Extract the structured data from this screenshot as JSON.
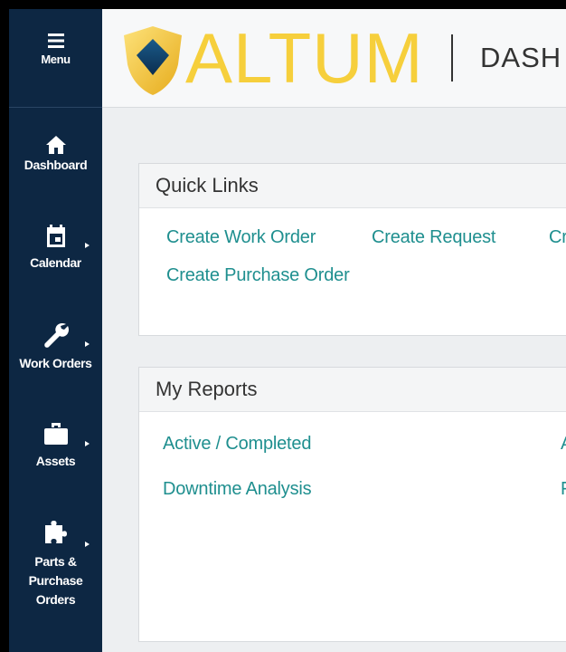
{
  "sidebar": {
    "menu_label": "Menu",
    "items": [
      {
        "label": "Dashboard",
        "icon": "home-icon"
      },
      {
        "label": "Calendar",
        "icon": "calendar-icon"
      },
      {
        "label": "Work Orders",
        "icon": "wrench-icon"
      },
      {
        "label": "Assets",
        "icon": "briefcase-icon"
      },
      {
        "label_lines": [
          "Parts &",
          "Purchase",
          "Orders"
        ],
        "icon": "puzzle-icon"
      }
    ]
  },
  "header": {
    "brand": "ALTUM",
    "title": "DASH"
  },
  "quick_links": {
    "title": "Quick Links",
    "links": [
      "Create Work Order",
      "Create Request",
      "Cr",
      "Create Purchase Order"
    ]
  },
  "reports": {
    "title": "My Reports",
    "links": [
      "Active / Completed",
      "A",
      "Downtime Analysis",
      "F"
    ]
  },
  "colors": {
    "sidebar_bg": "#0d2743",
    "brand_yellow": "#f6cf3c",
    "link_teal": "#1f8f8f"
  }
}
